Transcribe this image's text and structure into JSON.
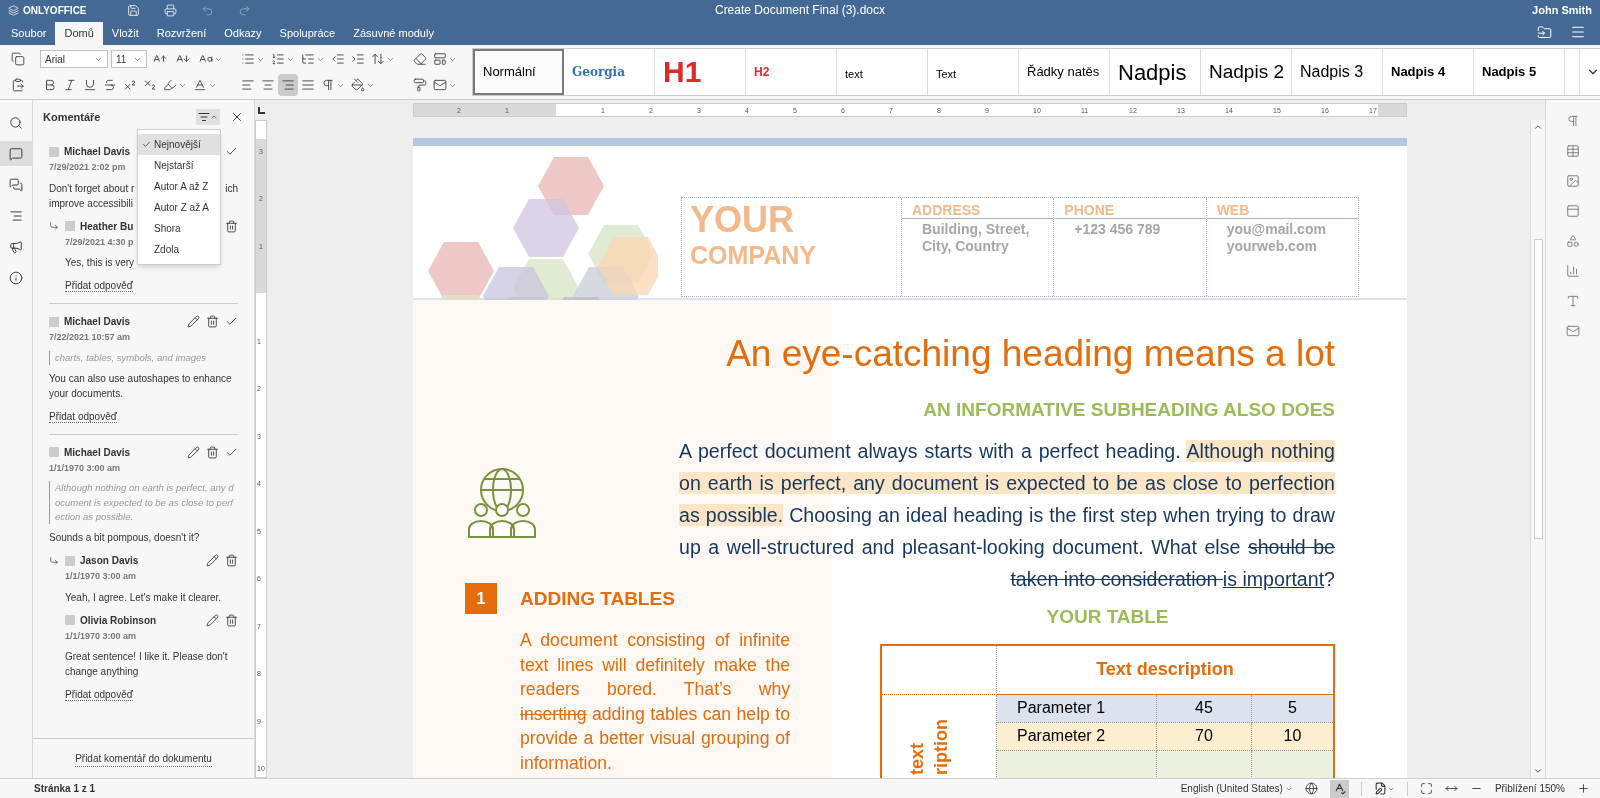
{
  "app": {
    "logo": "ONLYOFFICE",
    "title": "Create Document Final (3).docx",
    "user": "John Smith"
  },
  "menu_tabs": [
    {
      "label": "Soubor",
      "selected": false
    },
    {
      "label": "Domů",
      "selected": true
    },
    {
      "label": "Vložit",
      "selected": false
    },
    {
      "label": "Rozvržení",
      "selected": false
    },
    {
      "label": "Odkazy",
      "selected": false
    },
    {
      "label": "Spolupráce",
      "selected": false
    },
    {
      "label": "Zásuvné moduly",
      "selected": false
    }
  ],
  "toolbar": {
    "font": "Arial",
    "size": "11",
    "align_buttons": [
      {
        "kind": "left",
        "selected": false
      },
      {
        "kind": "center",
        "selected": false
      },
      {
        "kind": "right",
        "selected": true
      },
      {
        "kind": "justify",
        "selected": false
      }
    ],
    "styles": [
      {
        "label": "Normální",
        "kind": "normal",
        "selected": true
      },
      {
        "label": "Georgia",
        "kind": "georgia",
        "selected": false
      },
      {
        "label": "H1",
        "kind": "h1",
        "selected": false
      },
      {
        "label": "H2",
        "kind": "h2",
        "selected": false
      },
      {
        "label": "text",
        "kind": "small",
        "selected": false
      },
      {
        "label": "Text",
        "kind": "small",
        "selected": false
      },
      {
        "label": "Řádky natěs",
        "kind": "normal",
        "selected": false
      },
      {
        "label": "Nadpis",
        "kind": "title",
        "selected": false
      },
      {
        "label": "Nadpis 2",
        "kind": "heading",
        "selected": false
      },
      {
        "label": "Nadpis 3",
        "kind": "heading3",
        "selected": false
      },
      {
        "label": "Nadpis 4",
        "kind": "bold",
        "selected": false
      },
      {
        "label": "Nadpis 5",
        "kind": "bold",
        "selected": false
      }
    ]
  },
  "left_rail": [
    {
      "kind": "search",
      "selected": false
    },
    {
      "kind": "comments",
      "selected": true
    },
    {
      "kind": "chat",
      "selected": false
    },
    {
      "kind": "navigation",
      "selected": false
    },
    {
      "kind": "feedback",
      "selected": false
    },
    {
      "kind": "info",
      "selected": false
    }
  ],
  "comments": {
    "title": "Komentáře",
    "sort_menu": [
      {
        "label": "Nejnovější",
        "selected": true
      },
      {
        "label": "Nejstarší",
        "selected": false
      },
      {
        "label": "Autor A až Z",
        "selected": false
      },
      {
        "label": "Autor Z až A",
        "selected": false
      },
      {
        "label": "Shora",
        "selected": false
      },
      {
        "label": "Zdola",
        "selected": false
      }
    ],
    "threads": [
      {
        "author": "Michael Davis",
        "date": "7/29/2021 2:02 pm",
        "text_lines": [
          {
            "left": "Don't forget about r",
            "right": "ich"
          },
          {
            "left": "improve accessibili"
          }
        ],
        "replies": [
          {
            "author": "Heather Bu",
            "date": "7/29/2021 4:30 p",
            "text": "Yes, this is very"
          }
        ],
        "reply_link": "Přidat odpověď"
      },
      {
        "author": "Michael Davis",
        "date": "7/22/2021 10:57 am",
        "quote": "charts, tables, symbols, and images",
        "text_lines": [
          {
            "left": "You can also use autoshapes to enhance your documents."
          }
        ],
        "reply_link": "Přidat odpověď"
      },
      {
        "author": "Michael Davis",
        "date": "1/1/1970 3:00 am",
        "quote": "Although nothing on earth is perfect, any document is expected to be as close to perfection as possible.",
        "text_lines": [
          {
            "left": "Sounds a bit pompous, doesn't it?"
          }
        ],
        "replies": [
          {
            "author": "Jason Davis",
            "date": "1/1/1970 3:00 am",
            "text": "Yeah, I agree. Let's make it clearer."
          },
          {
            "author": "Olivia Robinson",
            "date": "1/1/1970 3:00 am",
            "text": "Great sentence! I like it. Please don't change anything"
          }
        ],
        "reply_link": "Přidat odpověď"
      }
    ],
    "add_comment": "Přidat komentář do dokumentu"
  },
  "rulers": {
    "horizontal_before": [
      "2",
      "1"
    ],
    "horizontal_after": [
      "1",
      "2",
      "3",
      "4",
      "5",
      "6",
      "7",
      "8",
      "9",
      "10",
      "11",
      "12",
      "13",
      "14",
      "15",
      "16",
      "17"
    ],
    "vertical_before": [
      "3",
      "2",
      "1"
    ],
    "vertical_after": [
      "1",
      "2",
      "3",
      "4",
      "5",
      "6",
      "7",
      "8",
      "9",
      "10"
    ]
  },
  "document": {
    "company_lines": [
      "YOUR",
      "COMPANY"
    ],
    "contact_columns": [
      {
        "label": "ADDRESS",
        "lines": [
          "Building, Street,",
          "City, Country"
        ]
      },
      {
        "label": "PHONE",
        "lines": [
          "+123 456 789"
        ]
      },
      {
        "label": "WEB",
        "lines": [
          "you@mail.com",
          "yourweb.com"
        ]
      }
    ],
    "heading": "An eye-catching heading means a lot",
    "subheading": "AN INFORMATIVE SUBHEADING ALSO DOES",
    "intro": [
      {
        "kind": "plain",
        "text": "A perfect document always starts with a perfect heading. "
      },
      {
        "kind": "highlight",
        "text": "Although nothing on earth is perfect, any document is expected to be as close to perfection as possible."
      },
      {
        "kind": "plain",
        "text": " Choosing an ideal heading is the first step when trying to draw up a well-structured and pleasant-looking document. What else "
      },
      {
        "kind": "deleted",
        "text": "should be taken into consideration "
      },
      {
        "kind": "inserted",
        "text": " is important"
      },
      {
        "kind": "plain",
        "text": "?"
      }
    ],
    "section": {
      "number": "1",
      "title": "ADDING TABLES",
      "body": [
        {
          "kind": "plain",
          "text": "A document consisting of infinite text lines will definitely make the readers bored. That’s why "
        },
        {
          "kind": "deleted",
          "text": "inserting"
        },
        {
          "kind": "plain",
          "text": " adding tables can help to provide a better visual grouping of information."
        }
      ]
    },
    "table": {
      "title": "YOUR TABLE",
      "header": "Text description",
      "side_label_lines": [
        "text",
        "ription"
      ],
      "rows": [
        {
          "cells": [
            "Parameter 1",
            "45",
            "5"
          ],
          "color": "#dce3ef"
        },
        {
          "cells": [
            "Parameter 2",
            "70",
            "10"
          ],
          "color": "#fdeed0"
        },
        {
          "color": "#ebf1de"
        }
      ]
    }
  },
  "status": {
    "page": "Stránka 1 z 1",
    "language": "English (United States)",
    "spellcheck_on": true,
    "zoom": "Přiblížení 150%"
  }
}
